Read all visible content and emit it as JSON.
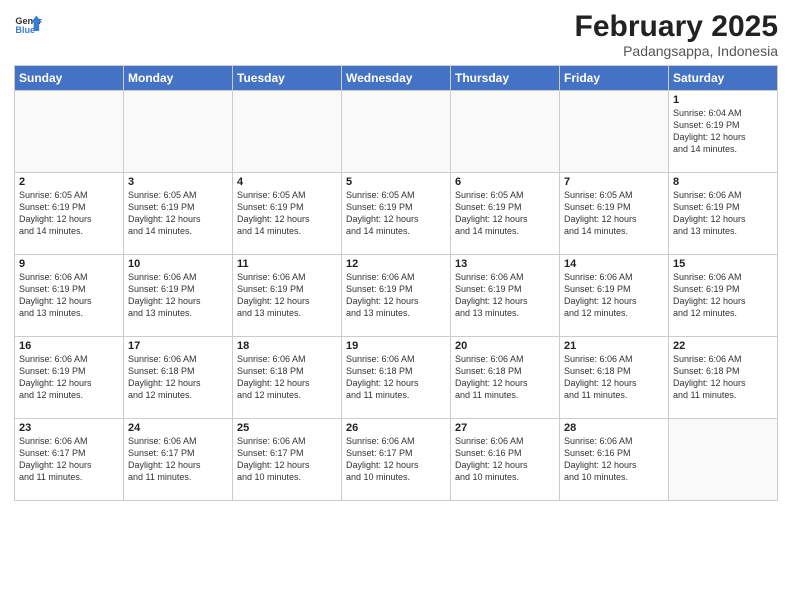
{
  "header": {
    "logo_general": "General",
    "logo_blue": "Blue",
    "month_title": "February 2025",
    "location": "Padangsappa, Indonesia"
  },
  "days_of_week": [
    "Sunday",
    "Monday",
    "Tuesday",
    "Wednesday",
    "Thursday",
    "Friday",
    "Saturday"
  ],
  "weeks": [
    [
      {
        "day": "",
        "info": ""
      },
      {
        "day": "",
        "info": ""
      },
      {
        "day": "",
        "info": ""
      },
      {
        "day": "",
        "info": ""
      },
      {
        "day": "",
        "info": ""
      },
      {
        "day": "",
        "info": ""
      },
      {
        "day": "1",
        "info": "Sunrise: 6:04 AM\nSunset: 6:19 PM\nDaylight: 12 hours\nand 14 minutes."
      }
    ],
    [
      {
        "day": "2",
        "info": "Sunrise: 6:05 AM\nSunset: 6:19 PM\nDaylight: 12 hours\nand 14 minutes."
      },
      {
        "day": "3",
        "info": "Sunrise: 6:05 AM\nSunset: 6:19 PM\nDaylight: 12 hours\nand 14 minutes."
      },
      {
        "day": "4",
        "info": "Sunrise: 6:05 AM\nSunset: 6:19 PM\nDaylight: 12 hours\nand 14 minutes."
      },
      {
        "day": "5",
        "info": "Sunrise: 6:05 AM\nSunset: 6:19 PM\nDaylight: 12 hours\nand 14 minutes."
      },
      {
        "day": "6",
        "info": "Sunrise: 6:05 AM\nSunset: 6:19 PM\nDaylight: 12 hours\nand 14 minutes."
      },
      {
        "day": "7",
        "info": "Sunrise: 6:05 AM\nSunset: 6:19 PM\nDaylight: 12 hours\nand 14 minutes."
      },
      {
        "day": "8",
        "info": "Sunrise: 6:06 AM\nSunset: 6:19 PM\nDaylight: 12 hours\nand 13 minutes."
      }
    ],
    [
      {
        "day": "9",
        "info": "Sunrise: 6:06 AM\nSunset: 6:19 PM\nDaylight: 12 hours\nand 13 minutes."
      },
      {
        "day": "10",
        "info": "Sunrise: 6:06 AM\nSunset: 6:19 PM\nDaylight: 12 hours\nand 13 minutes."
      },
      {
        "day": "11",
        "info": "Sunrise: 6:06 AM\nSunset: 6:19 PM\nDaylight: 12 hours\nand 13 minutes."
      },
      {
        "day": "12",
        "info": "Sunrise: 6:06 AM\nSunset: 6:19 PM\nDaylight: 12 hours\nand 13 minutes."
      },
      {
        "day": "13",
        "info": "Sunrise: 6:06 AM\nSunset: 6:19 PM\nDaylight: 12 hours\nand 13 minutes."
      },
      {
        "day": "14",
        "info": "Sunrise: 6:06 AM\nSunset: 6:19 PM\nDaylight: 12 hours\nand 12 minutes."
      },
      {
        "day": "15",
        "info": "Sunrise: 6:06 AM\nSunset: 6:19 PM\nDaylight: 12 hours\nand 12 minutes."
      }
    ],
    [
      {
        "day": "16",
        "info": "Sunrise: 6:06 AM\nSunset: 6:19 PM\nDaylight: 12 hours\nand 12 minutes."
      },
      {
        "day": "17",
        "info": "Sunrise: 6:06 AM\nSunset: 6:18 PM\nDaylight: 12 hours\nand 12 minutes."
      },
      {
        "day": "18",
        "info": "Sunrise: 6:06 AM\nSunset: 6:18 PM\nDaylight: 12 hours\nand 12 minutes."
      },
      {
        "day": "19",
        "info": "Sunrise: 6:06 AM\nSunset: 6:18 PM\nDaylight: 12 hours\nand 11 minutes."
      },
      {
        "day": "20",
        "info": "Sunrise: 6:06 AM\nSunset: 6:18 PM\nDaylight: 12 hours\nand 11 minutes."
      },
      {
        "day": "21",
        "info": "Sunrise: 6:06 AM\nSunset: 6:18 PM\nDaylight: 12 hours\nand 11 minutes."
      },
      {
        "day": "22",
        "info": "Sunrise: 6:06 AM\nSunset: 6:18 PM\nDaylight: 12 hours\nand 11 minutes."
      }
    ],
    [
      {
        "day": "23",
        "info": "Sunrise: 6:06 AM\nSunset: 6:17 PM\nDaylight: 12 hours\nand 11 minutes."
      },
      {
        "day": "24",
        "info": "Sunrise: 6:06 AM\nSunset: 6:17 PM\nDaylight: 12 hours\nand 11 minutes."
      },
      {
        "day": "25",
        "info": "Sunrise: 6:06 AM\nSunset: 6:17 PM\nDaylight: 12 hours\nand 10 minutes."
      },
      {
        "day": "26",
        "info": "Sunrise: 6:06 AM\nSunset: 6:17 PM\nDaylight: 12 hours\nand 10 minutes."
      },
      {
        "day": "27",
        "info": "Sunrise: 6:06 AM\nSunset: 6:16 PM\nDaylight: 12 hours\nand 10 minutes."
      },
      {
        "day": "28",
        "info": "Sunrise: 6:06 AM\nSunset: 6:16 PM\nDaylight: 12 hours\nand 10 minutes."
      },
      {
        "day": "",
        "info": ""
      }
    ]
  ]
}
